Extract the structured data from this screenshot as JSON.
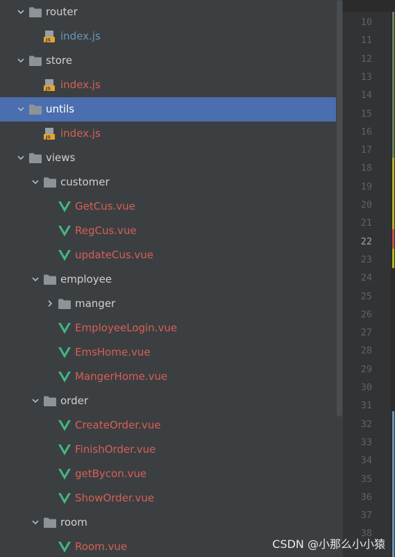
{
  "tree": [
    {
      "depth": 0,
      "kind": "folder",
      "expanded": true,
      "label": "router"
    },
    {
      "depth": 1,
      "kind": "js",
      "label": "index.js",
      "color": "blue"
    },
    {
      "depth": 0,
      "kind": "folder",
      "expanded": true,
      "label": "store"
    },
    {
      "depth": 1,
      "kind": "js",
      "label": "index.js",
      "color": "red"
    },
    {
      "depth": 0,
      "kind": "folder",
      "expanded": true,
      "label": "untils",
      "selected": true
    },
    {
      "depth": 1,
      "kind": "js",
      "label": "index.js",
      "color": "red"
    },
    {
      "depth": 0,
      "kind": "folder",
      "expanded": true,
      "label": "views"
    },
    {
      "depth": 1,
      "kind": "folder",
      "expanded": true,
      "label": "customer"
    },
    {
      "depth": 2,
      "kind": "vue",
      "label": "GetCus.vue"
    },
    {
      "depth": 2,
      "kind": "vue",
      "label": "RegCus.vue"
    },
    {
      "depth": 2,
      "kind": "vue",
      "label": "updateCus.vue"
    },
    {
      "depth": 1,
      "kind": "folder",
      "expanded": true,
      "label": "employee"
    },
    {
      "depth": 2,
      "kind": "folder",
      "expanded": false,
      "label": "manger"
    },
    {
      "depth": 2,
      "kind": "vue",
      "label": "EmployeeLogin.vue"
    },
    {
      "depth": 2,
      "kind": "vue",
      "label": "EmsHome.vue"
    },
    {
      "depth": 2,
      "kind": "vue",
      "label": "MangerHome.vue"
    },
    {
      "depth": 1,
      "kind": "folder",
      "expanded": true,
      "label": "order"
    },
    {
      "depth": 2,
      "kind": "vue",
      "label": "CreateOrder.vue"
    },
    {
      "depth": 2,
      "kind": "vue",
      "label": "FinishOrder.vue"
    },
    {
      "depth": 2,
      "kind": "vue",
      "label": "getBycon.vue"
    },
    {
      "depth": 2,
      "kind": "vue",
      "label": "ShowOrder.vue"
    },
    {
      "depth": 1,
      "kind": "folder",
      "expanded": true,
      "label": "room"
    },
    {
      "depth": 2,
      "kind": "vue",
      "label": "Room.vue"
    }
  ],
  "gutter": {
    "line_numbers": [
      "10",
      "11",
      "12",
      "13",
      "14",
      "15",
      "16",
      "17",
      "18",
      "19",
      "20",
      "21",
      "22",
      "23",
      "24",
      "25",
      "26",
      "27",
      "28",
      "29",
      "30",
      "31",
      "32",
      "33",
      "34",
      "35",
      "36",
      "37",
      "38"
    ],
    "current_line": "22"
  },
  "colors": {
    "selection": "#4b6eaf",
    "vcs_added": "#6a8759",
    "vcs_modified_yellow": "#bbb529",
    "vcs_modified_blue": "#6897bb",
    "vcs_red": "#c75450"
  },
  "watermark": "CSDN @小那么小小猿"
}
